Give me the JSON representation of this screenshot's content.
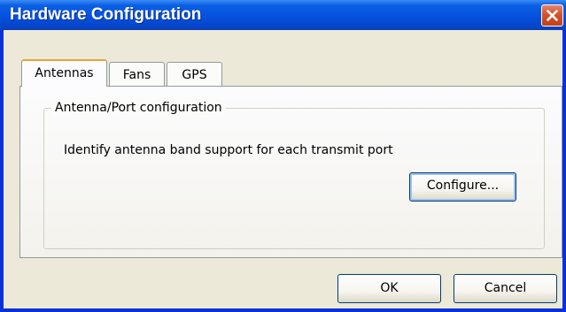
{
  "window": {
    "title": "Hardware Configuration",
    "close_icon": "close-icon"
  },
  "tabs": [
    {
      "label": "Antennas",
      "active": true
    },
    {
      "label": "Fans",
      "active": false
    },
    {
      "label": "GPS",
      "active": false
    }
  ],
  "antennas_panel": {
    "group_label": "Antenna/Port configuration",
    "description": "Identify antenna band support for each transmit port",
    "configure_label": "Configure..."
  },
  "footer": {
    "ok_label": "OK",
    "cancel_label": "Cancel"
  },
  "colors": {
    "titlebar": "#0651de",
    "close_button": "#d3532c",
    "dialog_face": "#ece9d8",
    "active_tab_accent": "#e6a539"
  }
}
